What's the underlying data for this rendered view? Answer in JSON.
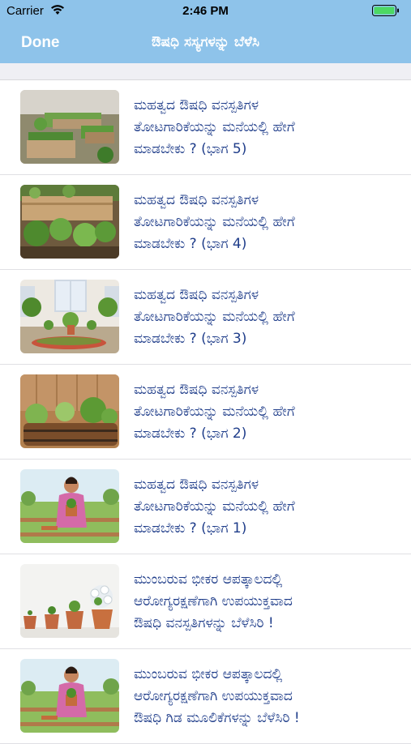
{
  "status_bar": {
    "carrier": "Carrier",
    "time": "2:46 PM"
  },
  "navbar": {
    "done_label": "Done",
    "title": "ಔಷಧಿ ಸಸ್ಯಗಳನ್ನು ಬೆಳೆಸಿ"
  },
  "items": [
    {
      "lines": [
        "ಮಹತ್ವದ ಔಷಧಿ ವನಸ್ಪತಿಗಳ",
        "ತೋಟಗಾರಿಕೆಯನ್ನು ಮನೆಯಲ್ಲಿ ಹೇಗೆ",
        "ಮಾಡಬೇಕು ? (ಭಾಗ 5)"
      ]
    },
    {
      "lines": [
        "ಮಹತ್ವದ ಔಷಧಿ ವನಸ್ಪತಿಗಳ",
        "ತೋಟಗಾರಿಕೆಯನ್ನು ಮನೆಯಲ್ಲಿ ಹೇಗೆ",
        "ಮಾಡಬೇಕು ? (ಭಾಗ 4)"
      ]
    },
    {
      "lines": [
        "ಮಹತ್ವದ ಔಷಧಿ ವನಸ್ಪತಿಗಳ",
        "ತೋಟಗಾರಿಕೆಯನ್ನು ಮನೆಯಲ್ಲಿ ಹೇಗೆ",
        "ಮಾಡಬೇಕು ? (ಭಾಗ 3)"
      ]
    },
    {
      "lines": [
        "ಮಹತ್ವದ ಔಷಧಿ ವನಸ್ಪತಿಗಳ",
        "ತೋಟಗಾರಿಕೆಯನ್ನು ಮನೆಯಲ್ಲಿ ಹೇಗೆ",
        "ಮಾಡಬೇಕು ? (ಭಾಗ 2)"
      ]
    },
    {
      "lines": [
        "ಮಹತ್ವದ ಔಷಧಿ ವನಸ್ಪತಿಗಳ",
        "ತೋಟಗಾರಿಕೆಯನ್ನು ಮನೆಯಲ್ಲಿ ಹೇಗೆ",
        "ಮಾಡಬೇಕು ? (ಭಾಗ 1)"
      ]
    },
    {
      "lines": [
        "ಮುಂಬರುವ ಭೀಕರ ಆಪತ್ಕಾಲದಲ್ಲಿ",
        "ಆರೋಗ್ಯರಕ್ಷಣೆಗಾಗಿ ಉಪಯುಕ್ತವಾದ",
        "ಔಷಧಿ ವನಸ್ಪತಿಗಳನ್ನು ಬೆಳೆಸಿರಿ !"
      ]
    },
    {
      "lines": [
        "ಮುಂಬರುವ ಭೀಕರ ಆಪತ್ಕಾಲದಲ್ಲಿ",
        "ಆರೋಗ್ಯರಕ್ಷಣೆಗಾಗಿ ಉಪಯುಕ್ತವಾದ",
        "ಔಷಧಿ ಗಿಡ ಮೂಲಿಕೆಗಳನ್ನು ಬೆಳೆಸಿರಿ !"
      ]
    }
  ],
  "colors": {
    "navbar": "#8ec3ea",
    "item_text": "#1f3d8a"
  }
}
